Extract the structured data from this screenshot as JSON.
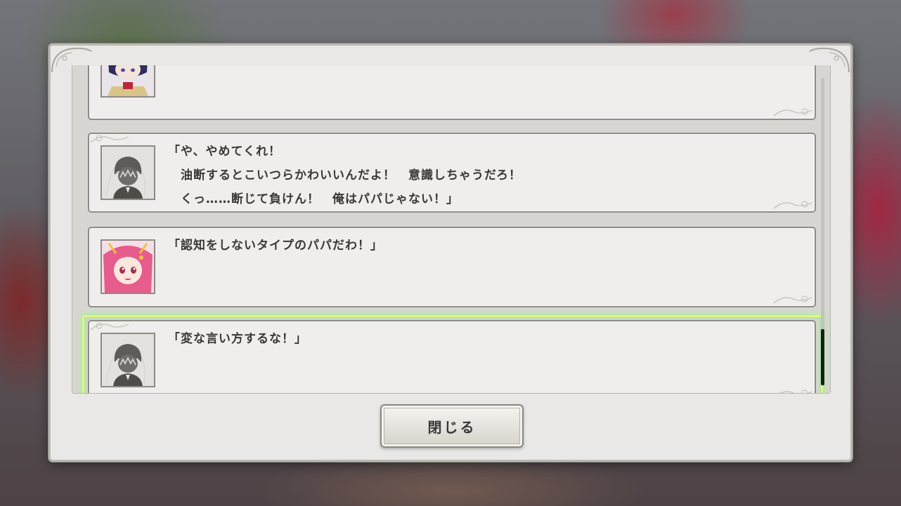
{
  "log": {
    "entries": [
      {
        "speaker_icon": "character-portrait-dark-hair-icon",
        "text": ""
      },
      {
        "speaker_icon": "silhouette-player-portrait-icon",
        "text": "「や、やめてくれ！\n　油断するとこいつらかわいいんだよ！　意識しちゃうだろ！\n　くっ……断じて負けん！　俺はパパじゃない！」"
      },
      {
        "speaker_icon": "pink-hair-character-portrait-icon",
        "text": "「認知をしないタイプのパパだわ！」"
      },
      {
        "speaker_icon": "silhouette-player-portrait-icon",
        "text": "「変な言い方するな！」",
        "selected": true
      }
    ]
  },
  "close_button": {
    "label": "閉じる"
  },
  "colors": {
    "panel": "#e9e8e6",
    "entry_bg": "#efeeec",
    "selection_glow": "#aaf0a0",
    "text": "#3a3836"
  }
}
